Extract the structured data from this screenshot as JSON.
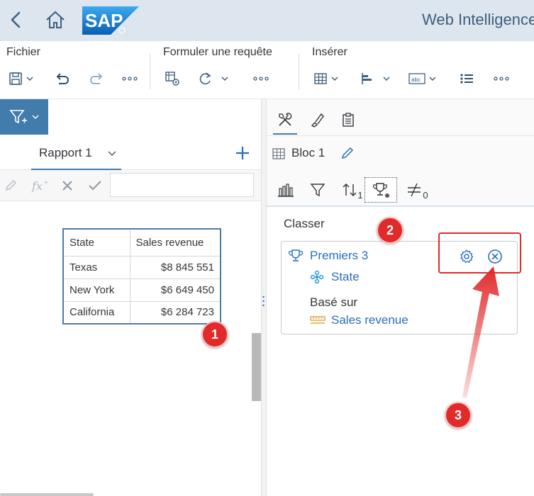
{
  "shell": {
    "app_title": "Web Intelligence",
    "logo_text": "SAP"
  },
  "toolbar": {
    "groups": [
      {
        "label": "Fichier"
      },
      {
        "label": "Formuler une requête"
      },
      {
        "label": "Insérer"
      }
    ]
  },
  "report": {
    "tab_label": "Rapport 1",
    "table": {
      "headers": [
        "State",
        "Sales revenue"
      ],
      "rows": [
        [
          "Texas",
          "$8 845 551"
        ],
        [
          "New York",
          "$6 649 450"
        ],
        [
          "California",
          "$6 284 723"
        ]
      ]
    }
  },
  "right_panel": {
    "bloc_label": "Bloc 1",
    "sort_count": "1",
    "input_control_count": "0",
    "section_title": "Classer",
    "ranking": {
      "title": "Premiers 3",
      "dimension": "State",
      "based_on_label": "Basé sur",
      "measure": "Sales revenue"
    }
  },
  "annotations": {
    "badge_1": "1",
    "badge_2": "2",
    "badge_3": "3"
  },
  "colors": {
    "accent": "#427cac",
    "annotation_red": "#e12a2a",
    "link_blue": "#2a6ebb",
    "shell_bg": "#dde6ef"
  }
}
